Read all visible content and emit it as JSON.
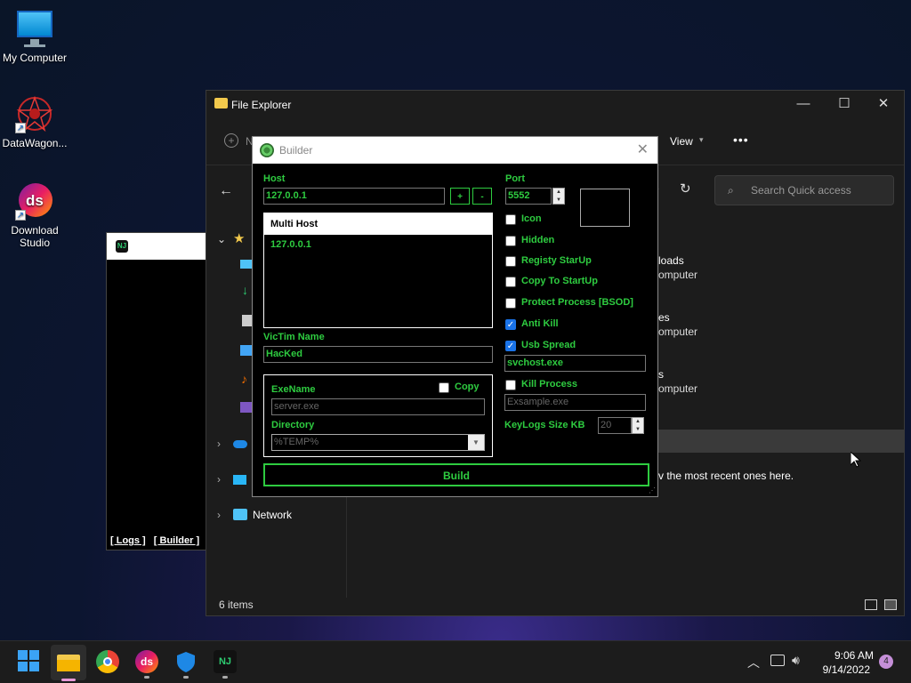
{
  "desktop": {
    "icons": [
      {
        "label": "My Computer"
      },
      {
        "label": "DataWagon..."
      },
      {
        "label": "Download Studio"
      }
    ]
  },
  "side_window": {
    "logs_link": "[ Logs ]",
    "builder_link": "[ Builder ]"
  },
  "explorer": {
    "title": "File Explorer",
    "toolbar": {
      "new_label": "N",
      "view_label": "View",
      "more_label": "•••"
    },
    "search_placeholder": "Search Quick access",
    "nav": {
      "network": "Network"
    },
    "recent": [
      {
        "name": "loads",
        "sub": "omputer"
      },
      {
        "name": "es",
        "sub": "omputer"
      },
      {
        "name": "s",
        "sub": "omputer"
      }
    ],
    "recent_hint": "v the most recent ones here.",
    "status": "6 items"
  },
  "builder": {
    "title": "Builder",
    "host_label": "Host",
    "host_value": "127.0.0.1",
    "add_btn": "+",
    "remove_btn": "-",
    "multi_host_header": "Multi Host",
    "multi_hosts": [
      "127.0.0.1"
    ],
    "victim_label": "VicTim Name",
    "victim_value": "HacKed",
    "exename_label": "ExeName",
    "copy_label": "Copy",
    "exename_placeholder": "server.exe",
    "directory_label": "Directory",
    "directory_value": "%TEMP%",
    "port_label": "Port",
    "port_value": "5552",
    "options": [
      {
        "label": "Icon",
        "checked": false
      },
      {
        "label": "Hidden",
        "checked": false
      },
      {
        "label": "Registy StarUp",
        "checked": false
      },
      {
        "label": "Copy To StartUp",
        "checked": false
      },
      {
        "label": "Protect Process [BSOD]",
        "checked": false
      },
      {
        "label": "Anti Kill",
        "checked": true
      },
      {
        "label": "Usb Spread",
        "checked": true
      }
    ],
    "usb_value": "svchost.exe",
    "kill_process_label": "Kill Process",
    "kill_process_placeholder": "Exsample.exe",
    "keylogs_label": "KeyLogs Size KB",
    "keylogs_value": "20",
    "build_button": "Build"
  },
  "taskbar": {
    "time": "9:06 AM",
    "date": "9/14/2022",
    "notification_count": "4"
  },
  "colors": {
    "accent_green": "#2ecc40",
    "checkbox_blue": "#1a73e8"
  }
}
